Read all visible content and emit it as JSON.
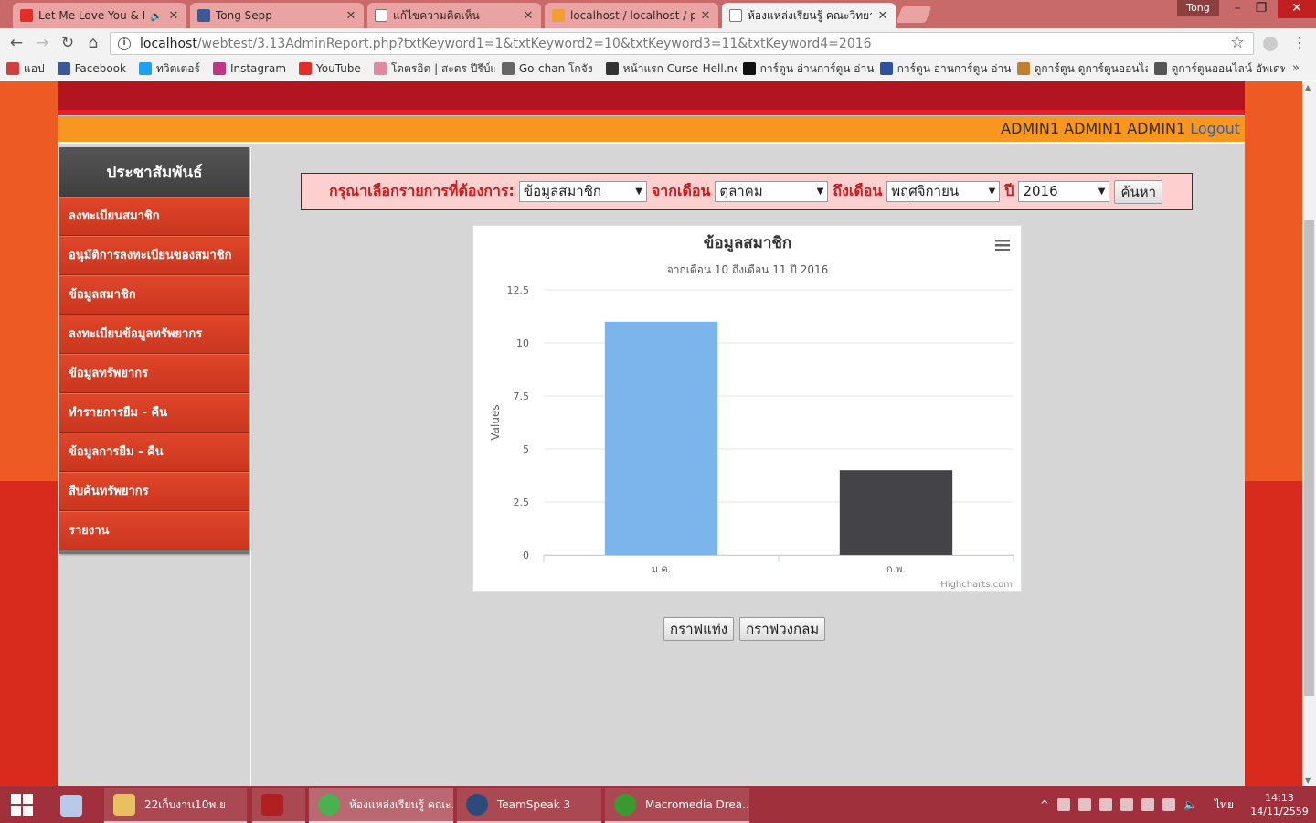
{
  "browser": {
    "tabs": [
      {
        "title": "Let Me Love You & Fa",
        "favicon_color": "#e52d27"
      },
      {
        "title": "Tong Sepp",
        "favicon_color": "#3b5998"
      },
      {
        "title": "แก้ไขความคิดเห็น",
        "favicon_color": "#ffffff"
      },
      {
        "title": "localhost / localhost / pr",
        "favicon_color": "#f0a030"
      },
      {
        "title": "ห้องแหล่งเรียนรู้ คณะวิทยาศ",
        "favicon_color": "#ffffff"
      }
    ],
    "user_badge": "Tong",
    "url_host": "localhost",
    "url_path": "/webtest/3.13AdminReport.php?txtKeyword1=1&txtKeyword2=10&txtKeyword3=11&txtKeyword4=2016",
    "bookmarks": [
      {
        "label": "แอป",
        "color": "#d04040"
      },
      {
        "label": "Facebook",
        "color": "#3b5998"
      },
      {
        "label": "ทวิตเตอร์",
        "color": "#1da1f2"
      },
      {
        "label": "Instagram",
        "color": "#c13584"
      },
      {
        "label": "YouTube",
        "color": "#e52d27"
      },
      {
        "label": "โดตรอิต | สะดร ปีรีบ์เกา",
        "color": "#e08aa0"
      },
      {
        "label": "Go-chan โกจัง",
        "color": "#666666"
      },
      {
        "label": "หน้าแรก Curse-Hell.net",
        "color": "#333333"
      },
      {
        "label": "การ์ตูน อ่านการ์ตูน อ่าน",
        "color": "#111111"
      },
      {
        "label": "การ์ตูน อ่านการ์ตูน อ่าน",
        "color": "#3050a0"
      },
      {
        "label": "ดูการ์ตูน ดูการ์ตูนออนไล",
        "color": "#c08030"
      },
      {
        "label": "ดูการ์ตูนออนไลน์ อัพเดท",
        "color": "#555555"
      }
    ]
  },
  "page": {
    "user_display": "ADMIN1 ADMIN1 ADMIN1",
    "logout_label": "Logout",
    "sidebar": {
      "title": "ประชาสัมพันธ์",
      "items": [
        {
          "label": "ลงทะเบียนสมาชิก"
        },
        {
          "label": "อนุมัติการลงทะเบียนของสมาชิก"
        },
        {
          "label": "ข้อมูลสมาชิก"
        },
        {
          "label": "ลงทะเบียนข้อมูลทรัพยากร"
        },
        {
          "label": "ข้อมูลทรัพยากร"
        },
        {
          "label": "ทำรายการยืม - คืน"
        },
        {
          "label": "ข้อมูลการยืม - คืน"
        },
        {
          "label": "สืบค้นทรัพยากร"
        },
        {
          "label": "รายงาน"
        }
      ]
    },
    "search": {
      "prompt": "กรุณาเลือกรายการที่ต้องการ:",
      "report_type": "ข้อมูลสมาชิก",
      "from_label": "จากเดือน",
      "from_month": "ตุลาคม",
      "to_label": "ถึงเดือน",
      "to_month": "พฤศจิกายน",
      "year_label": "ปี",
      "year": "2016",
      "submit_label": "ค้นหา"
    },
    "chart_buttons": {
      "bar_label": "กราฟแท่ง",
      "pie_label": "กราฟวงกลม"
    }
  },
  "chart_data": {
    "type": "bar",
    "title": "ข้อมูลสมาชิก",
    "subtitle": "จากเดือน 10 ถึงเดือน 11 ปี 2016",
    "ylabel": "Values",
    "xlabel": "",
    "categories": [
      "ม.ค.",
      "ก.พ."
    ],
    "values": [
      11,
      4
    ],
    "colors": [
      "#7cb5ec",
      "#434348"
    ],
    "ylim": [
      0,
      12.5
    ],
    "yticks": [
      "0",
      "2.5",
      "5",
      "7.5",
      "10",
      "12.5"
    ],
    "credits": "Highcharts.com",
    "grid": true
  },
  "taskbar": {
    "items": [
      {
        "label": "22เก็บงาน10พ.ย",
        "color": "#e8c060"
      },
      {
        "label": "",
        "color": "#b02020"
      },
      {
        "label": "ห้องแหล่งเรียนรู้ คณะ...",
        "color": "#4caf50"
      },
      {
        "label": "TeamSpeak 3",
        "color": "#2c4a7a"
      },
      {
        "label": "Macromedia Drea...",
        "color": "#3a9a30"
      }
    ],
    "ime": "ไทย",
    "time": "14:13",
    "date": "14/11/2559"
  }
}
